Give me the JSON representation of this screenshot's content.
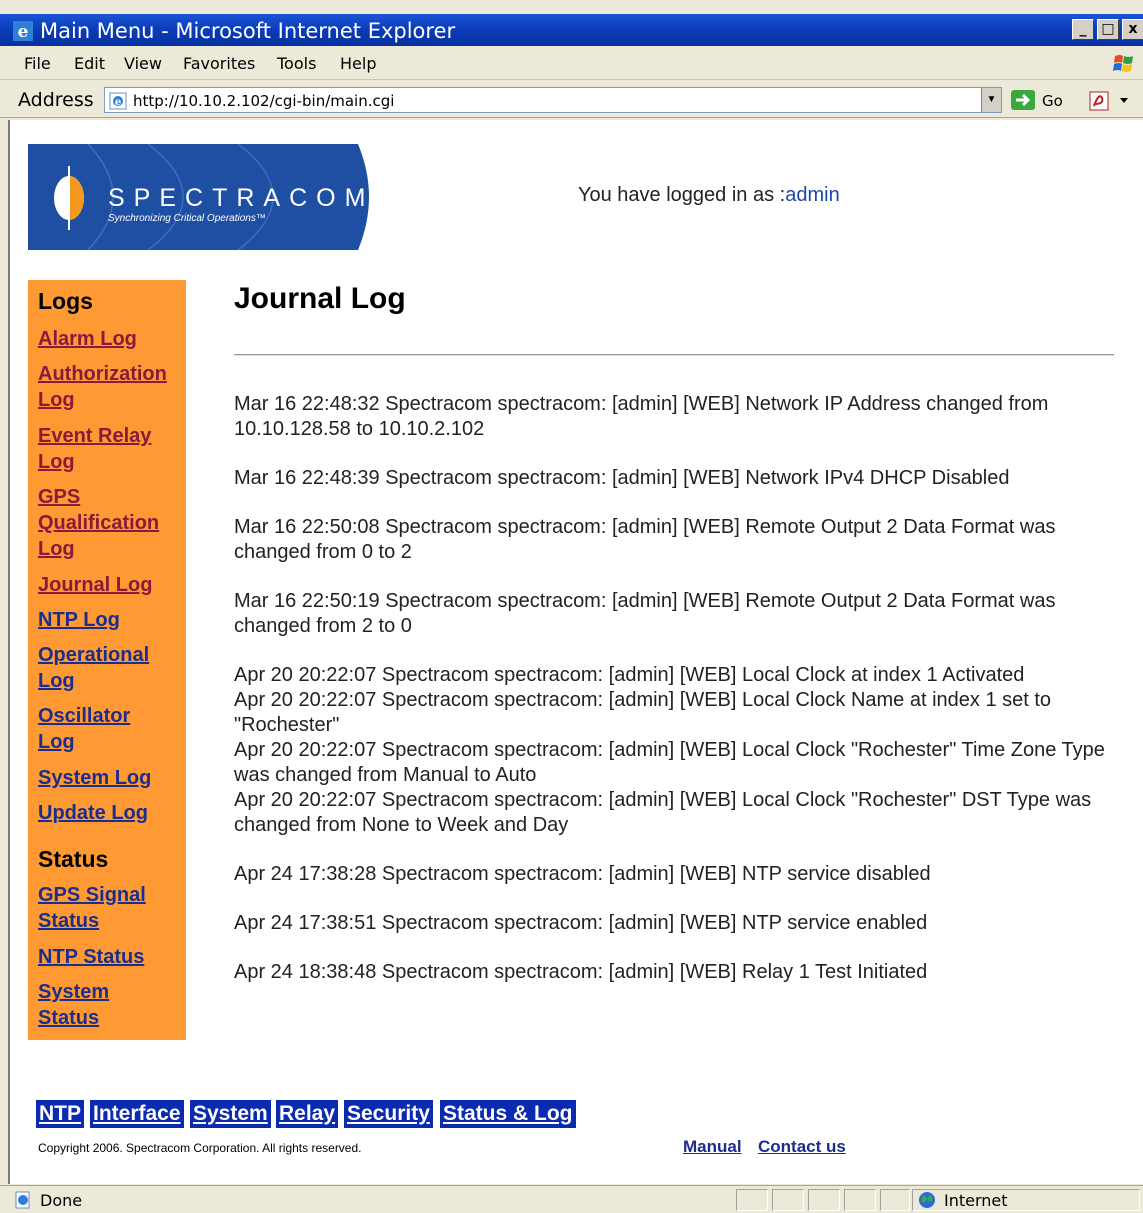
{
  "window": {
    "title": "Main Menu - Microsoft Internet Explorer",
    "minimize": "_",
    "maximize": "□",
    "close": "x"
  },
  "menu": [
    "File",
    "Edit",
    "View",
    "Favorites",
    "Tools",
    "Help"
  ],
  "address": {
    "label": "Address",
    "url": "http://10.10.2.102/cgi-bin/main.cgi",
    "go_label": "Go"
  },
  "header": {
    "logo_text": "SPECTRACOM",
    "logo_tagline": "Synchronizing Critical Operations™",
    "logged_in_prefix": "You have logged in as :",
    "logged_in_user": "admin"
  },
  "sidebar": {
    "logs_heading": "Logs",
    "status_heading": "Status",
    "logs": [
      "Alarm Log",
      "Authorization Log",
      "Event Relay Log",
      "GPS Qualification Log",
      "Journal Log",
      "NTP Log",
      "Operational Log",
      "Oscillator Log",
      "System Log",
      "Update Log"
    ],
    "status": [
      "GPS Signal Status",
      "NTP Status",
      "System Status"
    ]
  },
  "main": {
    "title": "Journal Log",
    "entries": [
      [
        "Mar 16 22:48:32 Spectracom spectracom: [admin] [WEB] Network IP Address changed from 10.10.128.58 to 10.10.2.102"
      ],
      [
        "Mar 16 22:48:39 Spectracom spectracom: [admin] [WEB] Network IPv4 DHCP Disabled"
      ],
      [
        "Mar 16 22:50:08 Spectracom spectracom: [admin] [WEB] Remote Output 2 Data Format was changed from 0 to 2"
      ],
      [
        "Mar 16 22:50:19 Spectracom spectracom: [admin] [WEB] Remote Output 2 Data Format was changed from 2 to 0"
      ],
      [
        "Apr 20 20:22:07 Spectracom spectracom: [admin] [WEB] Local Clock at index 1 Activated",
        "Apr 20 20:22:07 Spectracom spectracom: [admin] [WEB] Local Clock Name at index 1 set to \"Rochester\"",
        "Apr 20 20:22:07 Spectracom spectracom: [admin] [WEB] Local Clock \"Rochester\" Time Zone Type was changed from Manual to Auto",
        "Apr 20 20:22:07 Spectracom spectracom: [admin] [WEB] Local Clock \"Rochester\" DST Type was changed from None to Week and Day"
      ],
      [
        "Apr 24 17:38:28 Spectracom spectracom: [admin] [WEB] NTP service disabled"
      ],
      [
        "Apr 24 17:38:51 Spectracom spectracom: [admin] [WEB] NTP service enabled"
      ],
      [
        "Apr 24 18:38:48 Spectracom spectracom: [admin] [WEB] Relay 1 Test Initiated"
      ]
    ]
  },
  "footer": {
    "nav": [
      "NTP",
      "Interface",
      "System",
      "Relay",
      "Security",
      "Status & Log"
    ],
    "copyright": "Copyright 2006. Spectracom Corporation. All rights reserved.",
    "manual": "Manual",
    "contact": "Contact us"
  },
  "statusbar": {
    "text": "Done",
    "zone": "Internet"
  },
  "colors": {
    "sidebar_bg": "#ff9933",
    "nav_bg": "#0a2bb0",
    "logo_bg": "#1f4fa3"
  }
}
